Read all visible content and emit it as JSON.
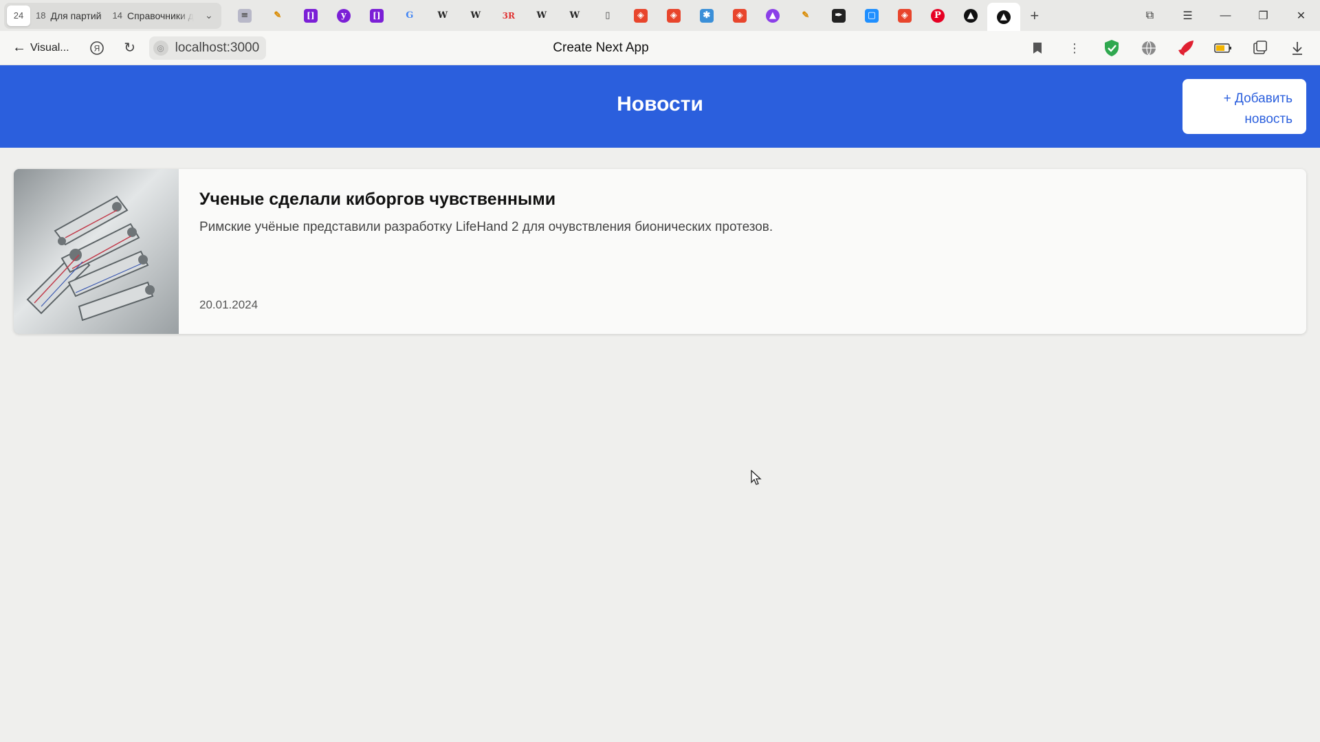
{
  "browser": {
    "tabs": [
      {
        "count": "24",
        "title": ""
      },
      {
        "count": "18",
        "title": "Для партий"
      },
      {
        "count": "14",
        "title": "Справочники д"
      }
    ],
    "pinned_icons": [
      {
        "name": "bookmark-stripe-icon",
        "glyph": "≡",
        "color": "#b8b8c8",
        "fg": "#555"
      },
      {
        "name": "pen-icon",
        "glyph": "✎",
        "color": "transparent",
        "fg": "#d98a00"
      },
      {
        "name": "purple-bracket-icon",
        "glyph": "[]",
        "color": "#7b1fd6",
        "fg": "#fff"
      },
      {
        "name": "purple-circle-icon",
        "glyph": "y",
        "color": "#7b1fd6",
        "fg": "#fff"
      },
      {
        "name": "purple-bracket-icon",
        "glyph": "[]",
        "color": "#7b1fd6",
        "fg": "#fff"
      },
      {
        "name": "google-icon",
        "glyph": "G",
        "color": "transparent",
        "fg": "#4285f4"
      },
      {
        "name": "wikipedia-icon",
        "glyph": "W",
        "color": "transparent",
        "fg": "#222"
      },
      {
        "name": "wikipedia-icon",
        "glyph": "W",
        "color": "transparent",
        "fg": "#222"
      },
      {
        "name": "3r-icon",
        "glyph": "3R",
        "color": "transparent",
        "fg": "#e03030"
      },
      {
        "name": "wikipedia-icon",
        "glyph": "W",
        "color": "transparent",
        "fg": "#222"
      },
      {
        "name": "wikipedia-icon",
        "glyph": "W",
        "color": "transparent",
        "fg": "#222"
      },
      {
        "name": "document-icon",
        "glyph": "▯",
        "color": "transparent",
        "fg": "#444"
      },
      {
        "name": "red-shield-icon",
        "glyph": "◈",
        "color": "#e8452c",
        "fg": "#fff"
      },
      {
        "name": "red-shield-icon",
        "glyph": "◈",
        "color": "#e8452c",
        "fg": "#fff"
      },
      {
        "name": "puzzle-icon",
        "glyph": "✱",
        "color": "#3a8fd8",
        "fg": "#fff"
      },
      {
        "name": "red-shield-icon",
        "glyph": "◈",
        "color": "#e8452c",
        "fg": "#fff"
      },
      {
        "name": "purple-triangle-icon",
        "glyph": "▲",
        "color": "#8b3fe8",
        "fg": "#fff"
      },
      {
        "name": "pen-icon",
        "glyph": "✎",
        "color": "transparent",
        "fg": "#d98a00"
      },
      {
        "name": "dark-feather-icon",
        "glyph": "✒",
        "color": "#222",
        "fg": "#fff"
      },
      {
        "name": "blue-chat-icon",
        "glyph": "▢",
        "color": "#1f8fff",
        "fg": "#fff"
      },
      {
        "name": "red-shield-icon",
        "glyph": "◈",
        "color": "#e8452c",
        "fg": "#fff"
      },
      {
        "name": "pinterest-icon",
        "glyph": "P",
        "color": "#e60023",
        "fg": "#fff"
      },
      {
        "name": "black-triangle-icon",
        "glyph": "▲",
        "color": "#111",
        "fg": "#fff"
      },
      {
        "name": "black-triangle-icon",
        "glyph": "▲",
        "color": "#111",
        "fg": "#fff"
      }
    ],
    "back_label": "Visual...",
    "url": "localhost:3000",
    "page_title": "Create Next App"
  },
  "app": {
    "header_title": "Новости",
    "add_button_label": "+ Добавить новость",
    "accent_color": "#2b5fdd",
    "news": [
      {
        "title": "Ученые сделали киборгов чувственными",
        "description": "Римские учёные представили разработку LifeHand 2 для очувствления бионических протезов.",
        "date": "20.01.2024"
      }
    ]
  }
}
